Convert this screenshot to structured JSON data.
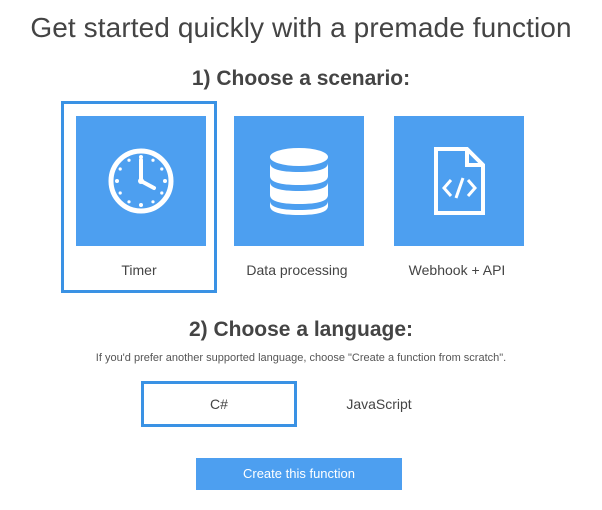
{
  "header": {
    "title": "Get started quickly with a premade function"
  },
  "scenario": {
    "heading": "1) Choose a scenario:",
    "tiles": [
      {
        "label": "Timer",
        "icon": "clock-icon",
        "selected": true
      },
      {
        "label": "Data processing",
        "icon": "database-icon",
        "selected": false
      },
      {
        "label": "Webhook + API",
        "icon": "code-file-icon",
        "selected": false
      }
    ]
  },
  "language": {
    "heading": "2) Choose a language:",
    "hint": "If you'd prefer another supported language, choose \"Create a function from scratch\".",
    "options": [
      {
        "label": "C#",
        "selected": true
      },
      {
        "label": "JavaScript",
        "selected": false
      }
    ]
  },
  "actions": {
    "create_label": "Create this function"
  },
  "colors": {
    "accent": "#4d9ff0",
    "selection_border": "#3a92e4",
    "text": "#444444"
  }
}
